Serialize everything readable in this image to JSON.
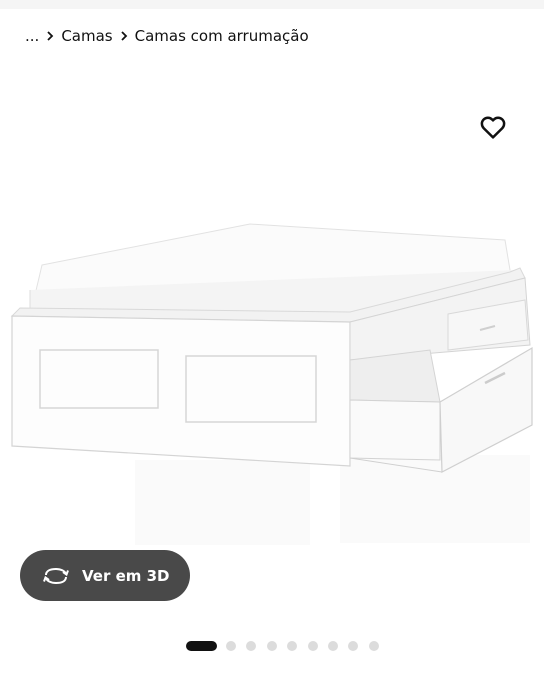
{
  "breadcrumb": {
    "ellipsis": "...",
    "items": [
      "Camas",
      "Camas com arrumação"
    ]
  },
  "product_image": {
    "alt": "Cama branca com gavetas de arrumação"
  },
  "favourite": {
    "icon": "heart-outline-icon"
  },
  "view3d": {
    "label": "Ver em 3D",
    "icon": "rotate-3d-icon"
  },
  "carousel": {
    "total": 9,
    "active_index": 0
  },
  "colors": {
    "button_bg": "#494949",
    "dot_active": "#111111",
    "dot_inactive": "#dcdcdc"
  }
}
